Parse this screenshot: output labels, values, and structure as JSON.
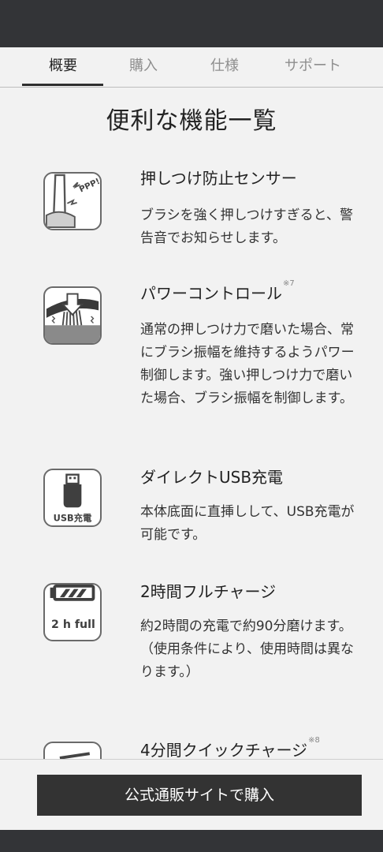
{
  "tabs": [
    {
      "label": "概要"
    },
    {
      "label": "購入"
    },
    {
      "label": "仕様"
    },
    {
      "label": "サポート"
    }
  ],
  "heading": "便利な機能一覧",
  "features": [
    {
      "title": "押しつけ防止センサー",
      "note": "",
      "description": [
        "ブラシを強く押しつけすぎると、警告音でお知らせします。"
      ],
      "icon": "pressure-sensor-icon",
      "icon_text": "PPP!"
    },
    {
      "title": "パワーコントロール",
      "note": "※7",
      "description": [
        "通常の押しつけ力で磨いた場合、常にブラシ振幅を維持するようパワー制御します。強い押しつけ力で磨いた場合、ブラシ振幅を制御します。"
      ],
      "icon": "power-control-icon"
    },
    {
      "title": "ダイレクトUSB充電",
      "note": "",
      "description": [
        "本体底面に直挿しして、USB充電が可能です。"
      ],
      "icon": "usb-charge-icon",
      "icon_text": "USB充電"
    },
    {
      "title": "2時間フルチャージ",
      "note": "",
      "description": [
        "約2時間の充電で約90分磨けます。",
        "（使用条件により、使用時間は異なります。）"
      ],
      "icon": "battery-full-icon",
      "icon_text": "2 h full"
    },
    {
      "title": "4分間クイックチャージ",
      "note": "※8",
      "description": [],
      "icon": "quick-charge-icon"
    }
  ],
  "buy_button": {
    "label": "公式通販サイトで購入"
  },
  "colors": {
    "dark_bar": "#333437",
    "button": "#333333",
    "background": "#f2f2f2",
    "icon_border": "#6a6a6a"
  }
}
